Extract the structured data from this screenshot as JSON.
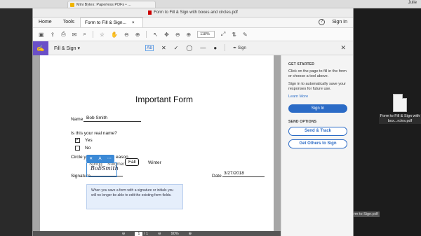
{
  "browser": {
    "tab_title": "Mini Bytes: Paperless PDFs • ...",
    "user": "Julie"
  },
  "window": {
    "title": "Form to Fill & Sign with boxes and circles.pdf"
  },
  "tabs": {
    "home": "Home",
    "tools": "Tools",
    "doc": "Form to Fill & Sign...",
    "doc_close": "×"
  },
  "top_right": {
    "help": "?",
    "signin": "Sign In"
  },
  "toolbar": {
    "zoom": "118%"
  },
  "fill_sign": {
    "label": "Fill & Sign",
    "dropdown": "▾",
    "ab": "Ab",
    "sign": "Sign",
    "close": "✕"
  },
  "form": {
    "title": "Important Form",
    "name_label": "Name",
    "name_value": "Bob Smith",
    "question": "Is this your real name?",
    "yes": "Yes",
    "no": "No",
    "circle_prefix": "Circle y",
    "season_suffix": "eason",
    "spring": "Spring",
    "summer": "Summer",
    "fall": "Fall",
    "winter": "Winter",
    "signature_label": "Signature",
    "signature_value": "BobSmith",
    "date_label": "Date",
    "date_value": "3/27/2018",
    "tip": "When you save a form with a signature or initials you will no longer be able to edit the existing form fields."
  },
  "bottom_bar": {
    "page_current": "1",
    "page_total": "/ 1",
    "zoom": "90%"
  },
  "right_panel": {
    "get_started": "GET STARTED",
    "p1": "Click on the page to fill in the form or choose a tool above.",
    "p2": "Sign in to automatically save your responses for future use.",
    "learn_more": "Learn More",
    "signin_btn": "Sign In",
    "send_options": "SEND OPTIONS",
    "send_track": "Send & Track",
    "get_others": "Get Others to Sign"
  },
  "desktop": {
    "file_label": "Form to Fill & Sign with box...rcles.pdf",
    "bottom_label": "orm to Sign.pdf"
  }
}
